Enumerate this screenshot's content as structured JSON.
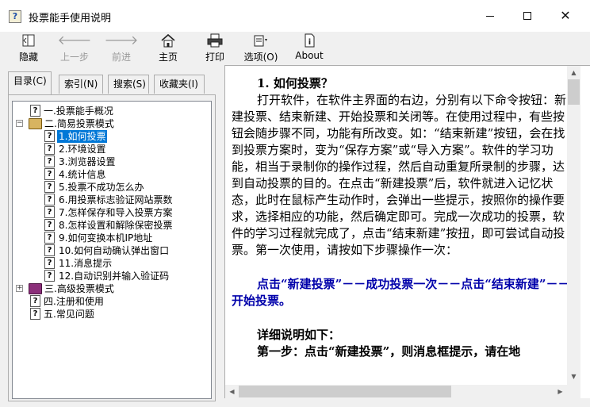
{
  "window": {
    "title": "投票能手使用说明",
    "icon": "help-book-icon"
  },
  "toolbar": {
    "hide_label": "隐藏",
    "back_label": "上一步",
    "forward_label": "前进",
    "home_label": "主页",
    "print_label": "打印",
    "options_label": "选项(O)",
    "about_label": "About"
  },
  "nav_tabs": {
    "contents": "目录(C)",
    "index": "索引(N)",
    "search": "搜索(S)",
    "favorites": "收藏夹(I)"
  },
  "tree": {
    "n1": "一.投票能手概况",
    "n2": "二.简易投票模式",
    "c1": "1.如何投票",
    "c2": "2.环境设置",
    "c3": "3.浏览器设置",
    "c4": "4.统计信息",
    "c5": "5.投票不成功怎么办",
    "c6": "6.用投票标志验证网站票数",
    "c7": "7.怎样保存和导入投票方案",
    "c8": "8.怎样设置和解除保密投票",
    "c9": "9.如何变换本机IP地址",
    "c10": "10.如何自动确认弹出窗口",
    "c11": "11.消息提示",
    "c12": "12.自动识别并输入验证码",
    "n3": "三.高级投票模式",
    "n4": "四.注册和使用",
    "n5": "五.常见问题",
    "selected": "1.如何投票"
  },
  "content": {
    "heading": "1. 如何投票？",
    "para1": "打开软件，在软件主界面的右边，分别有以下命令按钮：新建投票、结束新建、开始投票和关闭等。在使用过程中，有些按钮会随步骤不同，功能有所改变。如：“结束新建”按钮，会在找到投票方案时，变为“保存方案”或“导入方案”。软件的学习功能，相当于录制你的操作过程，然后自动重复所录制的步骤，达到自动投票的目的。在点击“新建投票”后，软件就进入记忆状态，此时在鼠标产生动作时，会弹出一些提示，按照你的操作要求，选择相应的功能，然后确定即可。完成一次成功的投票，软件的学习过程就完成了，点击“结束新建”按扭，即可尝试自动投票。第一次使用，请按如下步骤操作一次：",
    "emphasis": "点击“新建投票”－－成功投票一次－－点击“结束新建”－－开始投票。",
    "detail_heading": "详细说明如下：",
    "step1": "第一步：点击“新建投票”，则消息框提示，请在地"
  }
}
